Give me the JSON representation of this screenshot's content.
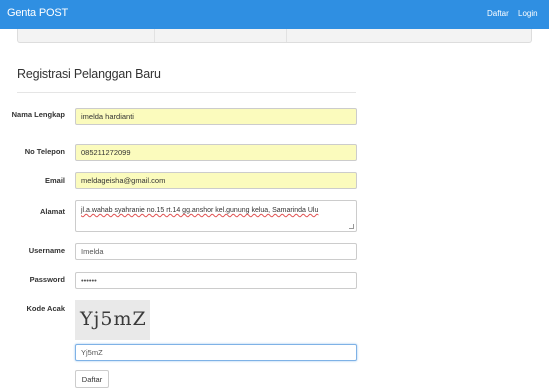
{
  "navbar": {
    "brand": "Genta POST",
    "links": [
      "Daftar",
      "Login"
    ]
  },
  "page": {
    "title": "Registrasi Pelanggan Baru"
  },
  "form": {
    "nama_label": "Nama Lengkap",
    "nama_value": "imelda hardianti",
    "telepon_label": "No Telepon",
    "telepon_value": "085211272099",
    "email_label": "Email",
    "email_value": "meldageisha@gmail.com",
    "alamat_label": "Alamat",
    "alamat_value": "jl.a.wahab syahranie no.15 rt.14 gg.anshor kel.gunung kelua, Samarinda Ulu",
    "username_label": "Username",
    "username_value": "Imelda",
    "password_label": "Password",
    "password_value": "••••••",
    "kode_label": "Kode Acak",
    "captcha_text": "Yj5mZ",
    "kode_value": "Yj5mZ",
    "submit_label": "Daftar"
  }
}
